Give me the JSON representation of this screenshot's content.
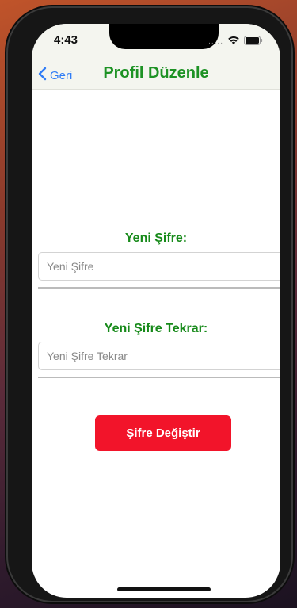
{
  "status_bar": {
    "time": "4:43",
    "dots": "....."
  },
  "nav": {
    "back_label": "Geri",
    "title": "Profil Düzenle"
  },
  "form": {
    "new_password_label": "Yeni Şifre:",
    "new_password_placeholder": "Yeni Şifre",
    "new_password_value": "",
    "confirm_label": "Yeni Şifre Tekrar:",
    "confirm_placeholder": "Yeni Şifre Tekrar",
    "confirm_value": "",
    "submit_label": "Şifre Değiştir"
  },
  "colors": {
    "title_green": "#1d9224",
    "label_green": "#178a1a",
    "button_red": "#f2142a",
    "link_blue": "#2f7cf6",
    "header_bg": "#f4f5ef"
  },
  "icons": {
    "back": "chevron-left-icon",
    "wifi": "wifi-icon",
    "battery": "battery-icon"
  }
}
